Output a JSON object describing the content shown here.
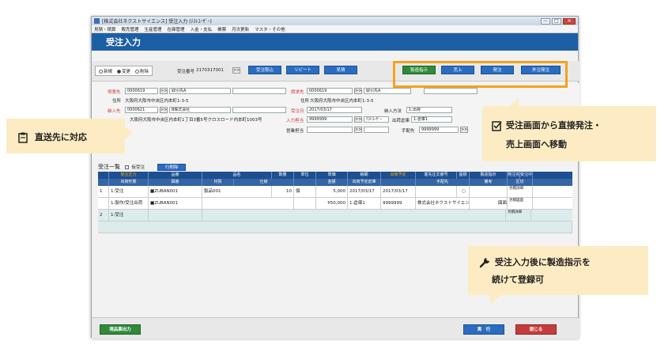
{
  "window": {
    "title": "[株式会社ネクストサイエンス] 受注入力 (ﾃｽﾄﾕｰｻﾞｰ)",
    "min_label": "—",
    "max_label": "□",
    "close_label": "✕"
  },
  "menu": [
    "見積・積算",
    "販売管理",
    "生産管理",
    "在庫管理",
    "入金・支払",
    "帳票",
    "月次更新",
    "マスタ・その他"
  ],
  "page_title": "受注入力",
  "mode": {
    "options": [
      "新規",
      "変更",
      "削除"
    ],
    "selected": "変更"
  },
  "order_no_label": "受注番号",
  "order_no": "2170317001",
  "toolbar": {
    "import_label": "受注取込",
    "repeat_label": "リピート",
    "estimate_label": "見積",
    "manufacture_label": "製造指示",
    "sales_label": "売上",
    "order_label": "発注",
    "outsource_label": "外注発注"
  },
  "form": {
    "customer_label": "得意先",
    "customer_code": "0000619",
    "customer_name": "取引先A",
    "customer_addr_label": "住所",
    "customer_addr": "大阪府大阪市中央区内本町1-3-5",
    "billing_label": "請求先",
    "billing_code": "0000619",
    "billing_name": "取引先A",
    "billing_addr_label": "住所",
    "billing_addr": "大阪府大阪市中央区内本町1-3-5",
    "ship_label": "納入先",
    "ship_code": "0000621",
    "ship_name": "B株式会社",
    "ship_addr": "大阪府大阪市中央区内本町1丁目3番5号クロスロード内本町1003号",
    "order_date_label": "受注日",
    "order_date": "2017/03/17",
    "delivery_method_label": "納入方法",
    "delivery_method": "1:出荷",
    "input_person_label": "入力担当",
    "input_person_code": "9999999",
    "input_person_name": "ﾃｽﾄﾕｰｻﾞｰ",
    "ship_warehouse_label": "出荷倉庫",
    "ship_warehouse": "1:倉庫1",
    "sales_person_label": "営業担当",
    "arrangement_label": "手配先",
    "arrangement_code": "9999999",
    "arrow": ">>"
  },
  "grid": {
    "title": "受注一覧",
    "provisional_label": "仮受注",
    "delete_row_label": "行削除",
    "header1": [
      "受注区分",
      "品番",
      "品名",
      "数量",
      "単位",
      "単価",
      "納期",
      "出荷予定",
      "客先注文番号",
      "屋標",
      "製造指示",
      "発注完了",
      "受注中止"
    ],
    "header2": [
      "出荷形態",
      "図番",
      "材質",
      "仕様",
      "",
      "金額",
      "出荷予定倉庫",
      "",
      "手配先",
      "",
      "備考",
      "区切",
      "",
      ""
    ],
    "rows": [
      {
        "no": "1",
        "r1": {
          "kind": "1:受注",
          "part": "■ZUBAN001",
          "name": "製品001",
          "qty": "10",
          "unit": "個",
          "price": "5,000",
          "due": "2017/03/17",
          "ship": "2017/03/17",
          "mark": "○",
          "est": "見積詳細"
        },
        "r2": {
          "kind": "1:製作/受注出荷",
          "part": "■ZUBAN001",
          "amount": "¥50,000",
          "wh": "1:倉庫1",
          "arr": "9999999",
          "arr_name": "株式会社ネクストサイエン",
          "sep": "図面",
          "est": "見積図面"
        }
      },
      {
        "no": "2",
        "r1": {
          "kind": "1:受注",
          "est": "見積詳細"
        }
      }
    ]
  },
  "footer": {
    "invoice_label": "現品票出力",
    "execute_label": "実　行",
    "close_label": "閉じる"
  },
  "callouts": {
    "direct_ship": "直送先に対応",
    "order_from": "受注画面から直接発注・",
    "order_from2": "売上画面へ移動",
    "mfg_after": "受注入力後に製造指示を",
    "mfg_after2": "続けて登録可"
  },
  "colors": {
    "header_blue": "#1d5fa5",
    "accent_orange": "#f5a21b",
    "callout_bg": "#fdecc3",
    "manufacture_green": "#2f8a3a",
    "close_red": "#c63b3b"
  },
  "icons": [
    "clipboard-icon",
    "checklist-icon",
    "wrench-icon"
  ]
}
